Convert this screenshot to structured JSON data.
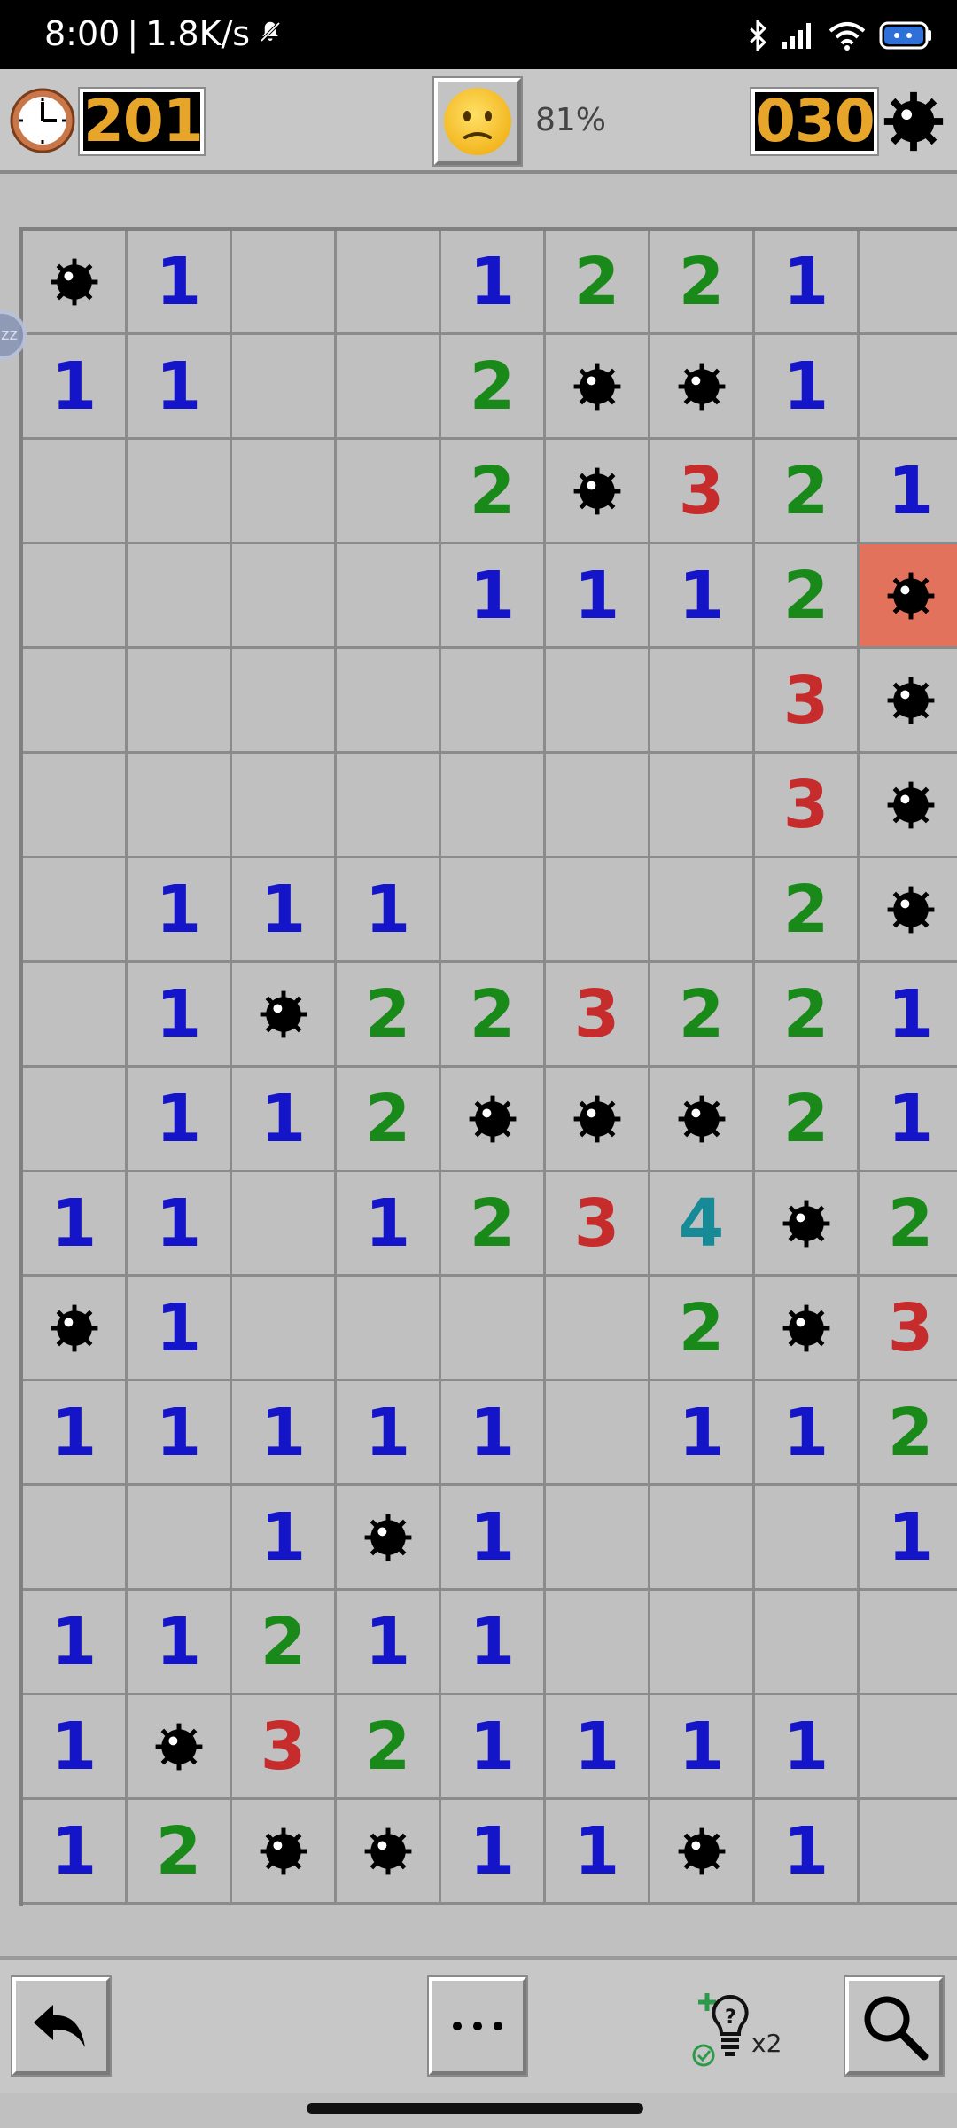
{
  "status_bar": {
    "time": "8:00",
    "separator": "|",
    "net_speed": "1.8K/s",
    "icons": [
      "mute-bell-icon",
      "bluetooth-icon",
      "signal-icon",
      "wifi-icon",
      "battery-icon"
    ]
  },
  "header": {
    "timer": "201",
    "progress": "81%",
    "mines_left": "030",
    "face": "neutral-face-icon"
  },
  "board": {
    "columns": 9,
    "rows": [
      [
        "M",
        "1",
        "",
        "",
        "1",
        "2",
        "2",
        "1",
        ""
      ],
      [
        "1",
        "1",
        "",
        "",
        "2",
        "M",
        "M",
        "1",
        ""
      ],
      [
        "",
        "",
        "",
        "",
        "2",
        "M",
        "3",
        "2",
        "1"
      ],
      [
        "",
        "",
        "",
        "",
        "1",
        "1",
        "1",
        "2",
        "X"
      ],
      [
        "",
        "",
        "",
        "",
        "",
        "",
        "",
        "3",
        "M"
      ],
      [
        "",
        "",
        "",
        "",
        "",
        "",
        "",
        "3",
        "M"
      ],
      [
        "",
        "1",
        "1",
        "1",
        "",
        "",
        "",
        "2",
        "M"
      ],
      [
        "",
        "1",
        "M",
        "2",
        "2",
        "3",
        "2",
        "2",
        "1"
      ],
      [
        "",
        "1",
        "1",
        "2",
        "M",
        "M",
        "M",
        "2",
        "1"
      ],
      [
        "1",
        "1",
        "",
        "1",
        "2",
        "3",
        "4",
        "M",
        "2"
      ],
      [
        "M",
        "1",
        "",
        "",
        "",
        "",
        "2",
        "M",
        "3"
      ],
      [
        "1",
        "1",
        "1",
        "1",
        "1",
        "",
        "1",
        "1",
        "2"
      ],
      [
        "",
        "",
        "1",
        "M",
        "1",
        "",
        "",
        "",
        "1"
      ],
      [
        "1",
        "1",
        "2",
        "1",
        "1",
        "",
        "",
        "",
        ""
      ],
      [
        "1",
        "M",
        "3",
        "2",
        "1",
        "1",
        "1",
        "1",
        ""
      ],
      [
        "1",
        "2",
        "M",
        "M",
        "1",
        "1",
        "M",
        "1",
        ""
      ]
    ],
    "legend": {
      "M": "mine",
      "X": "exploded-mine"
    },
    "number_colors": {
      "1": "#1414c8",
      "2": "#198a19",
      "3": "#c62c2c",
      "4": "#168a96"
    },
    "exploded_color": "#e3725d"
  },
  "toolbar": {
    "undo": "undo-arrow-icon",
    "more_label": "···",
    "hint_count": "x2",
    "search": "magnifier-icon"
  },
  "side_tab": {
    "label": "zz"
  }
}
